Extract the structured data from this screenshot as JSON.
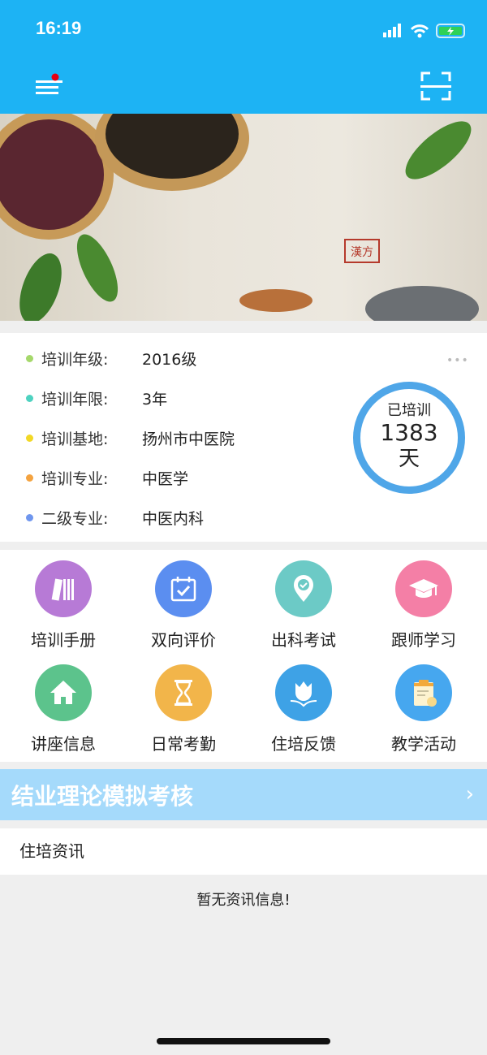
{
  "status_bar": {
    "time": "16:19"
  },
  "nav": {
    "menu_icon": "menu-icon",
    "scan_icon": "scan-icon",
    "accent": "#1db3f4",
    "badge_color": "#e60012"
  },
  "banner": {
    "seal_text": "漢方"
  },
  "info": {
    "rows": [
      {
        "label": "培训年级:",
        "value": "2016级",
        "dot": "#a5d86b"
      },
      {
        "label": "培训年限:",
        "value": "3年",
        "dot": "#4ed2c0"
      },
      {
        "label": "培训基地:",
        "value": "扬州市中医院",
        "dot": "#f2d826"
      },
      {
        "label": "培训专业:",
        "value": "中医学",
        "dot": "#f4a340"
      },
      {
        "label": "二级专业:",
        "value": "中医内科",
        "dot": "#6f96ee"
      }
    ],
    "more": "•••",
    "trained": {
      "label": "已培训",
      "days": "1383",
      "unit": "天"
    }
  },
  "grid": [
    {
      "label": "培训手册",
      "icon": "book-icon",
      "color": "#b77ad6"
    },
    {
      "label": "双向评价",
      "icon": "calendar-check-icon",
      "color": "#5b8ef0"
    },
    {
      "label": "出科考试",
      "icon": "location-check-icon",
      "color": "#6ccac6"
    },
    {
      "label": "跟师学习",
      "icon": "graduation-cap-icon",
      "color": "#f47fa6"
    },
    {
      "label": "讲座信息",
      "icon": "home-icon",
      "color": "#5cc38c"
    },
    {
      "label": "日常考勤",
      "icon": "hourglass-icon",
      "color": "#f2b54a"
    },
    {
      "label": "住培反馈",
      "icon": "tulip-icon",
      "color": "#3ea2e6"
    },
    {
      "label": "教学活动",
      "icon": "clipboard-icon",
      "color": "#46a7ef"
    }
  ],
  "exam_banner": {
    "title": "结业理论模拟考核",
    "chevron": "›"
  },
  "news": {
    "title": "住培资讯",
    "empty": "暂无资讯信息!"
  }
}
